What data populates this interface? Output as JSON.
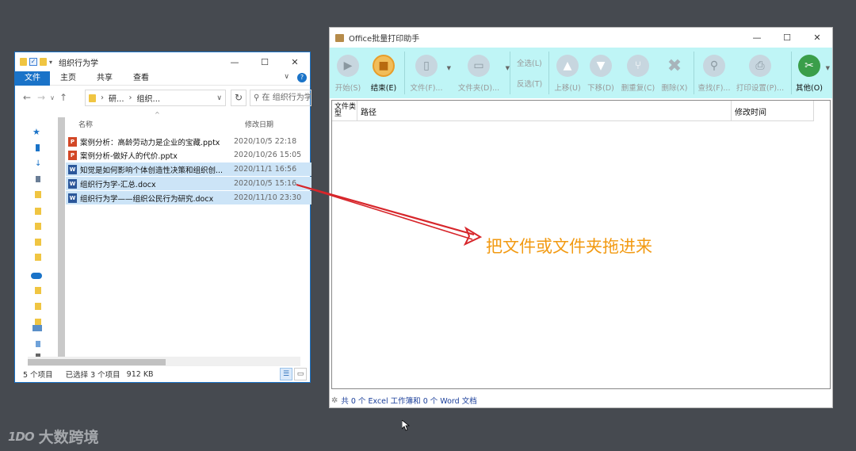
{
  "explorer": {
    "title": "组织行为学",
    "ribbon_tabs": [
      "文件",
      "主页",
      "共享",
      "查看"
    ],
    "address_parts": [
      "研...",
      "组织..."
    ],
    "search_placeholder": "在 组织行为学",
    "columns": {
      "name": "名称",
      "modified": "修改日期"
    },
    "files": [
      {
        "name": "案例分析：高龄劳动力是企业的宝藏.pptx",
        "date": "2020/10/5 22:18",
        "type": "pptx",
        "selected": false
      },
      {
        "name": "案例分析-做好人的代价.pptx",
        "date": "2020/10/26 15:05",
        "type": "pptx",
        "selected": false
      },
      {
        "name": "知觉是如何影响个体创造性决策和组织创...",
        "date": "2020/11/1 16:56",
        "type": "docx",
        "selected": true
      },
      {
        "name": "组织行为学-汇总.docx",
        "date": "2020/10/5 15:16",
        "type": "docx",
        "selected": true
      },
      {
        "name": "组织行为学——组织公民行为研究.docx",
        "date": "2020/11/10 23:30",
        "type": "docx",
        "selected": true
      }
    ],
    "status_count": "5 个项目",
    "status_selected": "已选择 3 个项目",
    "status_size": "912 KB"
  },
  "printer": {
    "title": "Office批量打印助手",
    "toolbar": {
      "start": "开始(S)",
      "end": "结束(E)",
      "file": "文件(F)...",
      "folder": "文件夹(D)...",
      "select_all": "全选(L)",
      "invert": "反选(T)",
      "move_up": "上移(U)",
      "move_down": "下移(D)",
      "dedupe": "删重复(C)",
      "delete": "删除(X)",
      "find": "查找(F)...",
      "print_settings": "打印设置(P)...",
      "other": "其他(O)"
    },
    "list_headers": {
      "type": "文件类型",
      "path": "路径",
      "modified": "修改时间"
    },
    "hint": "把文件或文件夹拖进来",
    "status": "共 0 个 Excel 工作簿和 0 个 Word 文档"
  },
  "watermark": {
    "logo": "1DO",
    "text": "大数跨境"
  },
  "colors": {
    "toolbar_bg": "#bff5f6",
    "hint": "#f29a12",
    "arrow": "#d7262b",
    "selection": "#cce4f7",
    "explorer_accent": "#1a73c8"
  }
}
